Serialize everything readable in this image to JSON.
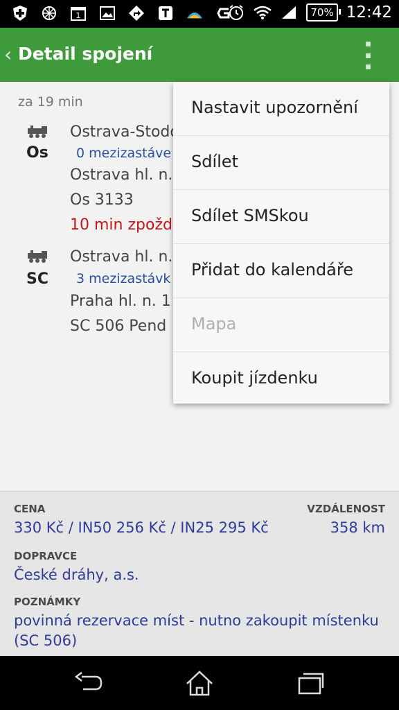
{
  "status_bar": {
    "icons": [
      "plus-shield-icon",
      "network-globe-icon",
      "calendar-icon",
      "gallery-icon",
      "navigation-icon",
      "text-icon",
      "weather-icon",
      "g-icon"
    ],
    "battery": "70%",
    "time": "12:42"
  },
  "action_bar": {
    "title": "Detail spojení"
  },
  "content": {
    "time_label": "za 19 min",
    "segments": [
      {
        "type": "Os",
        "lines": [
          "Ostrava-Stodo",
          "0 mezizastáve",
          "Ostrava hl. n.",
          "Os 3133",
          "10 min zpožd"
        ]
      },
      {
        "type": "SC",
        "lines": [
          "Ostrava hl. n.",
          "3 mezizastávk",
          "Praha hl. n.  1",
          "SC 506 Pend"
        ]
      }
    ]
  },
  "info": {
    "price_label": "CENA",
    "price_value": "330 Kč / IN50 256 Kč / IN25 295 Kč",
    "distance_label": "VZDÁLENOST",
    "distance_value": "358 km",
    "carrier_label": "DOPRAVCE",
    "carrier_value": "České dráhy, a.s.",
    "notes_label": "POZNÁMKY",
    "notes_value_1": "povinná rezervace míst - nutno zakoupit místenku",
    "notes_value_2": "(SC 506)"
  },
  "menu": {
    "items": [
      {
        "label": "Nastavit upozornění",
        "enabled": true
      },
      {
        "label": "Sdílet",
        "enabled": true
      },
      {
        "label": "Sdílet SMSkou",
        "enabled": true
      },
      {
        "label": "Přidat do kalendáře",
        "enabled": true
      },
      {
        "label": "Mapa",
        "enabled": false
      },
      {
        "label": "Koupit jízdenku",
        "enabled": true
      }
    ]
  },
  "colors": {
    "action_bar": "#3f9a3c",
    "link_blue": "#2f3a98",
    "delay_red": "#c01818"
  }
}
